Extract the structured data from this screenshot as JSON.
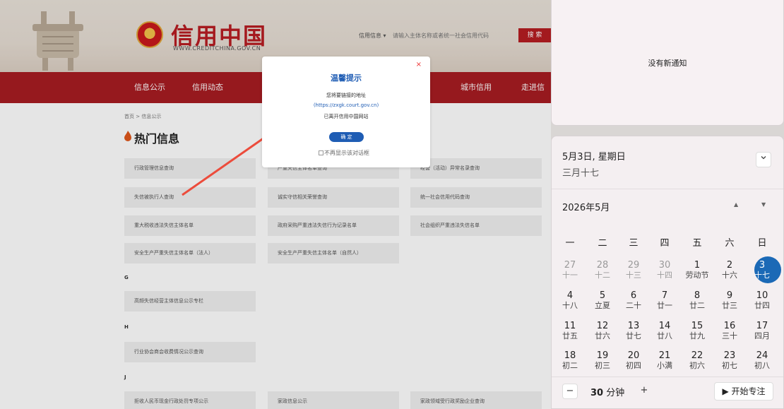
{
  "site": {
    "logo_title": "信用中国",
    "logo_sub": "WWW.CREDITCHINA.GOV.CN",
    "search_type": "信用信息 ▾",
    "search_placeholder": "请输入主体名称或者统一社会信用代码",
    "search_button": "搜 索",
    "nav": [
      "信息公示",
      "信用动态",
      "城市信用",
      "走进信用"
    ],
    "breadcrumb": "首页 > 信息公示",
    "page_title": "热门信息",
    "rows": [
      [
        "行政管理信息查询",
        "严重失信主体名单查询",
        "经营（活动）异常名录查询"
      ],
      [
        "失信被执行人查询",
        "诚实守信相关荣誉查询",
        "统一社会信用代码查询"
      ],
      [
        "重大税收违法失信主体名单",
        "政府采购严重违法失信行为记录名单",
        "社会组织严重违法失信名单"
      ],
      [
        "安全生产严重失信主体名单（法人）",
        "安全生产严重失信主体名单（自然人）",
        ""
      ]
    ],
    "group_g": "G",
    "g_item": "高频失信经营主体信息公示专栏",
    "group_h": "H",
    "h_item": "行业协会商会收费情况公示查询",
    "group_j": "J",
    "j_items": [
      "拒收人民币现金行政处罚专项公示",
      "家政信息公示",
      "家政领域受行政奖励企业查询"
    ]
  },
  "dialog": {
    "close": "×",
    "title": "温馨提示",
    "line1": "您将要链接的地址",
    "link": "(https://zxgk.court.gov.cn)",
    "line2": "已离开信用中国网站",
    "ok": "确 定",
    "checkbox": "不再显示该对话框"
  },
  "notifications": {
    "empty_text": "没有新通知"
  },
  "calendar": {
    "date": "5月3日, 星期日",
    "lunar": "三月十七",
    "collapse_icon": "chevron-down-icon",
    "month": "2026年5月",
    "weekdays": [
      "一",
      "二",
      "三",
      "四",
      "五",
      "六",
      "日"
    ],
    "weeks": [
      [
        [
          "27",
          "十一"
        ],
        [
          "28",
          "十二"
        ],
        [
          "29",
          "十三"
        ],
        [
          "30",
          "十四"
        ],
        [
          "1",
          "劳动节"
        ],
        [
          "2",
          "十六"
        ],
        [
          "3",
          "十七"
        ]
      ],
      [
        [
          "4",
          "十八"
        ],
        [
          "5",
          "立夏"
        ],
        [
          "6",
          "二十"
        ],
        [
          "7",
          "廿一"
        ],
        [
          "8",
          "廿二"
        ],
        [
          "9",
          "廿三"
        ],
        [
          "10",
          "廿四"
        ]
      ],
      [
        [
          "11",
          "廿五"
        ],
        [
          "12",
          "廿六"
        ],
        [
          "13",
          "廿七"
        ],
        [
          "14",
          "廿八"
        ],
        [
          "15",
          "廿九"
        ],
        [
          "16",
          "三十"
        ],
        [
          "17",
          "四月"
        ]
      ],
      [
        [
          "18",
          "初二"
        ],
        [
          "19",
          "初三"
        ],
        [
          "20",
          "初四"
        ],
        [
          "21",
          "小满"
        ],
        [
          "22",
          "初六"
        ],
        [
          "23",
          "初七"
        ],
        [
          "24",
          "初八"
        ]
      ]
    ],
    "today_index": [
      0,
      6
    ],
    "dim_days": [
      [
        0,
        0
      ],
      [
        0,
        1
      ],
      [
        0,
        2
      ],
      [
        0,
        3
      ]
    ],
    "focus_minus": "−",
    "focus_value": "30",
    "focus_unit": " 分钟",
    "focus_plus": "+",
    "focus_start": "▶ 开始专注",
    "accent": "#1b69b6"
  }
}
